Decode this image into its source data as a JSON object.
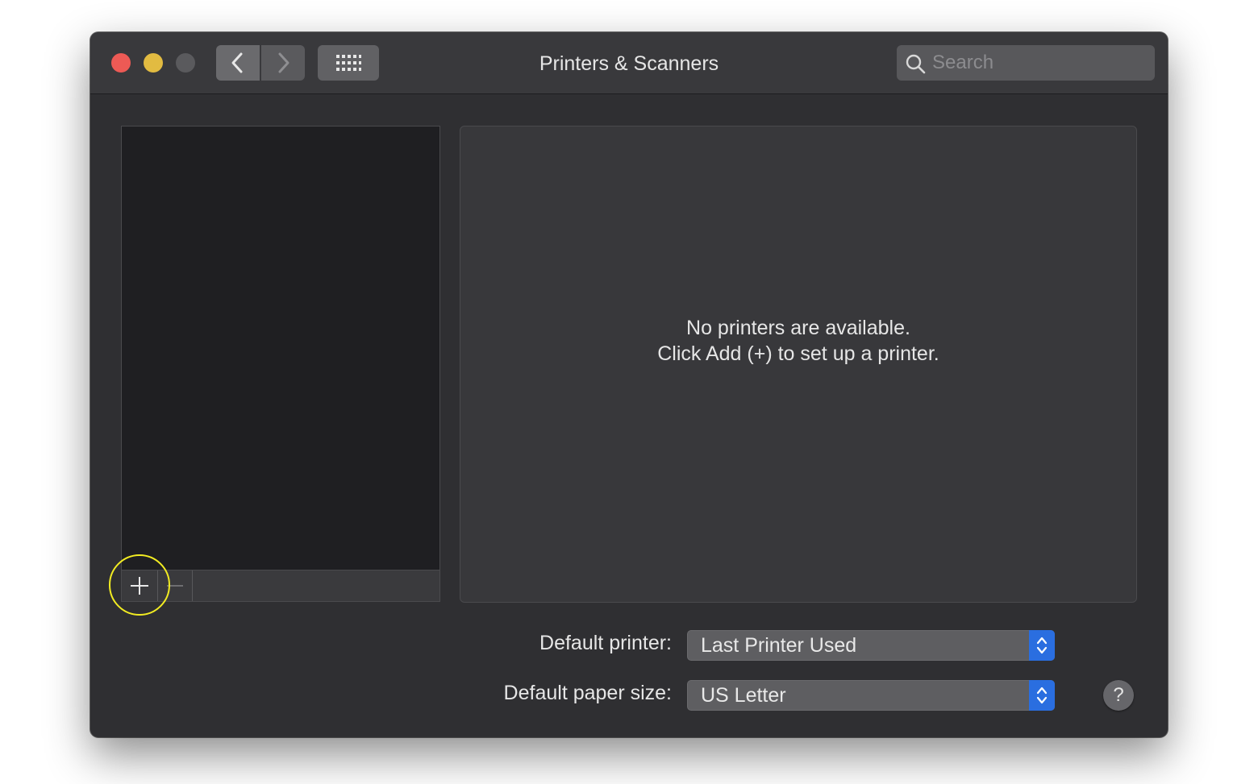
{
  "window": {
    "title": "Printers & Scanners"
  },
  "toolbar": {
    "back_icon": "chevron-left-icon",
    "forward_icon": "chevron-right-icon",
    "grid_icon": "grid-icon"
  },
  "search": {
    "placeholder": "Search",
    "value": ""
  },
  "printer_list": {
    "items": [],
    "add_label": "+",
    "remove_label": "−"
  },
  "detail": {
    "empty_line1": "No printers are available.",
    "empty_line2": "Click Add (+) to set up a printer."
  },
  "form": {
    "default_printer_label": "Default printer:",
    "default_printer_value": "Last Printer Used",
    "default_paper_label": "Default paper size:",
    "default_paper_value": "US Letter"
  },
  "help": {
    "label": "?"
  },
  "colors": {
    "close": "#ed5a55",
    "minimize": "#e2bb41",
    "zoom_disabled": "#5a5a5d",
    "accent": "#2a6ee0",
    "highlight_ring": "#f2ec22"
  }
}
